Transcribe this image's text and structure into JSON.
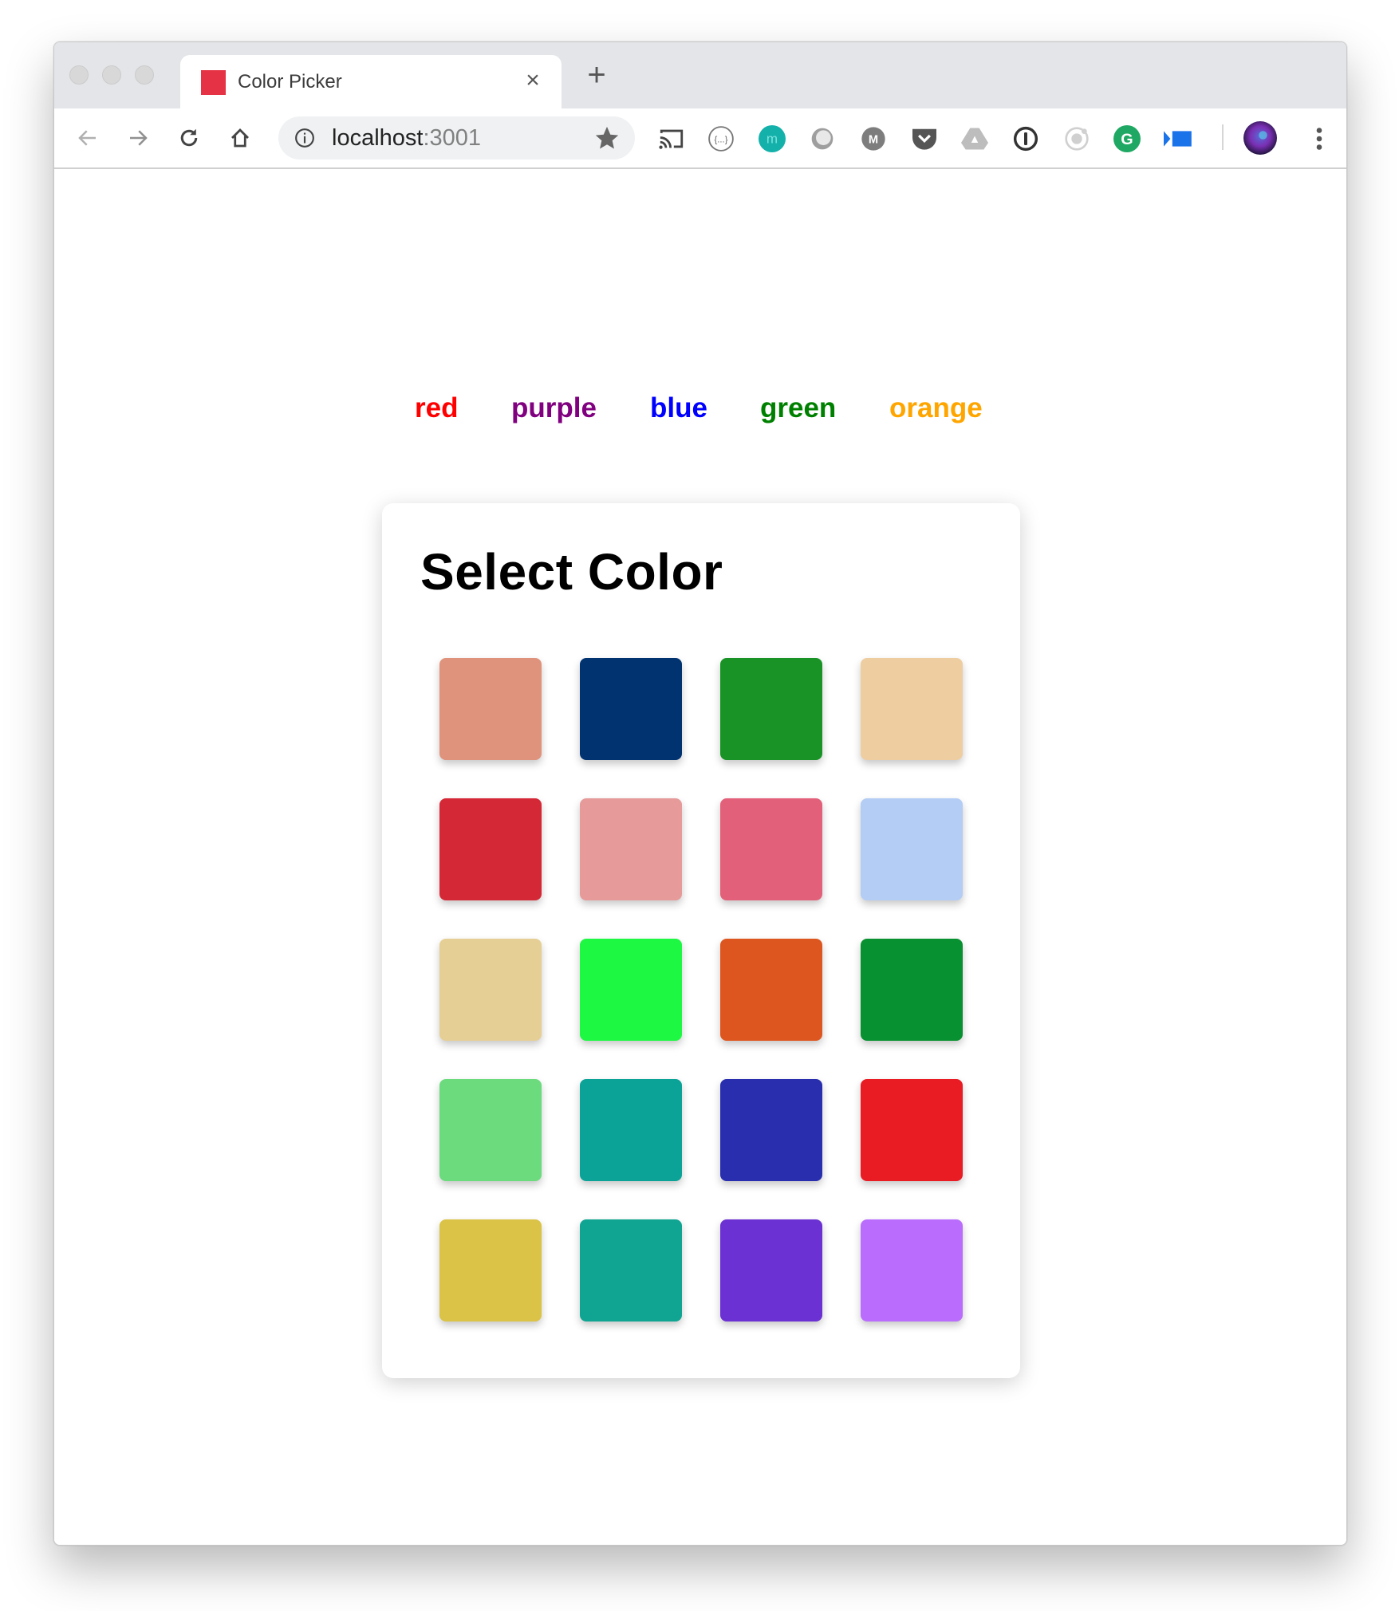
{
  "browser": {
    "tab_title": "Color Picker",
    "favicon_color": "#e53244",
    "close_tab_label": "×",
    "new_tab_label": "+",
    "url_host": "localhost",
    "url_port": ":3001"
  },
  "extensions": [
    {
      "name": "cast-icon"
    },
    {
      "name": "json-viewer-icon"
    },
    {
      "name": "mercury-icon",
      "label": "m"
    },
    {
      "name": "extension-circle-icon"
    },
    {
      "name": "momentum-icon",
      "label": "M"
    },
    {
      "name": "pocket-icon"
    },
    {
      "name": "google-drive-icon"
    },
    {
      "name": "onepassword-icon"
    },
    {
      "name": "ionic-icon"
    },
    {
      "name": "grammarly-icon",
      "label": "G"
    },
    {
      "name": "screencast-icon"
    }
  ],
  "color_nav": [
    {
      "label": "red",
      "color": "#ff0000"
    },
    {
      "label": "purple",
      "color": "#800080"
    },
    {
      "label": "blue",
      "color": "#0000ff"
    },
    {
      "label": "green",
      "color": "#008000"
    },
    {
      "label": "orange",
      "color": "#ffa500"
    }
  ],
  "card": {
    "title": "Select Color",
    "swatches": [
      [
        "#df937c",
        "#023371",
        "#199326",
        "#eecda1"
      ],
      [
        "#d52836",
        "#e69a9a",
        "#e3607a",
        "#b3cdf5"
      ],
      [
        "#e6cf95",
        "#1df843",
        "#de561f",
        "#089130"
      ],
      [
        "#6bdb7e",
        "#0ba398",
        "#282eae",
        "#e91b23"
      ],
      [
        "#dbc347",
        "#0fa592",
        "#6b31d3",
        "#ba6dfd"
      ]
    ]
  }
}
